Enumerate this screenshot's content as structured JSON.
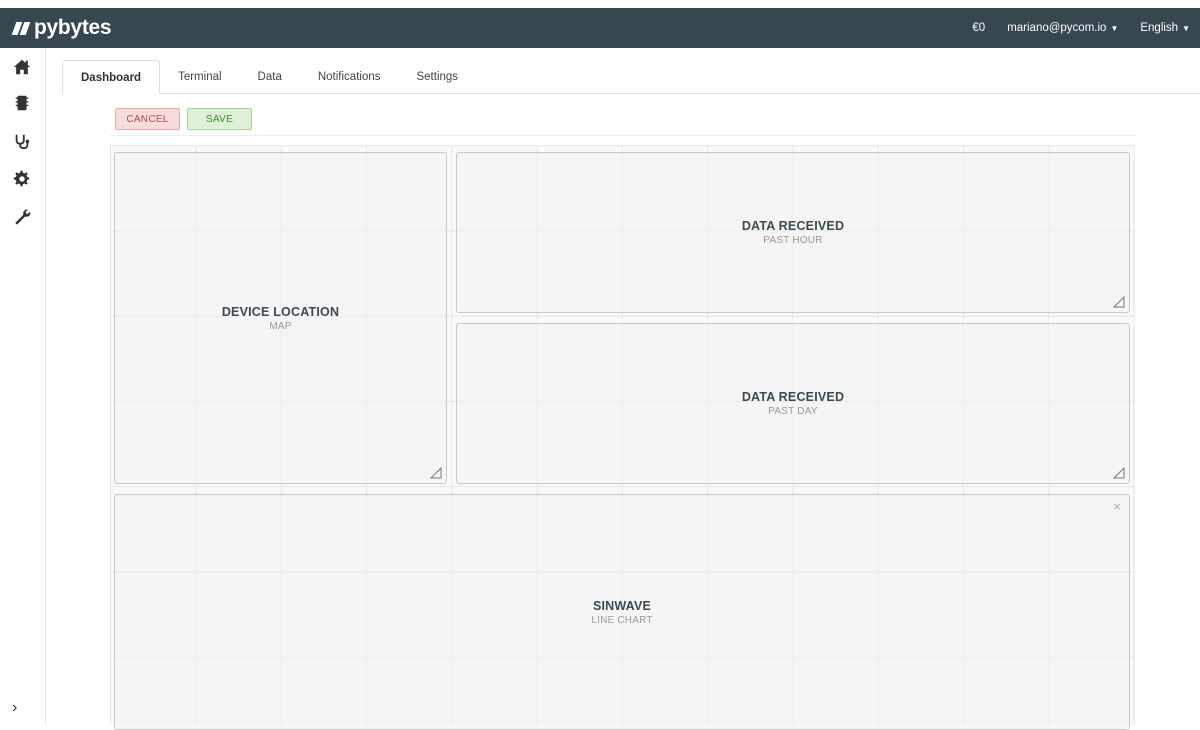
{
  "app": {
    "name": "pybytes"
  },
  "header": {
    "balance": "€0",
    "user": "mariano@pycom.io",
    "language": "English"
  },
  "sidebar": {
    "icons": [
      "home-icon",
      "device-chip-icon",
      "stethoscope-icon",
      "gear-icon",
      "wrench-icon"
    ],
    "expand_icon": "chevron-right-icon"
  },
  "tabs": [
    {
      "label": "Dashboard",
      "active": true
    },
    {
      "label": "Terminal",
      "active": false
    },
    {
      "label": "Data",
      "active": false
    },
    {
      "label": "Notifications",
      "active": false
    },
    {
      "label": "Settings",
      "active": false
    }
  ],
  "actions": {
    "cancel_label": "CANCEL",
    "save_label": "SAVE"
  },
  "widgets": {
    "device_location": {
      "title": "DEVICE LOCATION",
      "subtitle": "MAP"
    },
    "data_hour": {
      "title": "DATA RECEIVED",
      "subtitle": "PAST HOUR"
    },
    "data_day": {
      "title": "DATA RECEIVED",
      "subtitle": "PAST DAY"
    },
    "sinwave": {
      "title": "SINWAVE",
      "subtitle": "LINE CHART"
    }
  },
  "colors": {
    "topbar": "#37474f",
    "cancel": "#b24a4a",
    "save": "#3c8c2c"
  }
}
